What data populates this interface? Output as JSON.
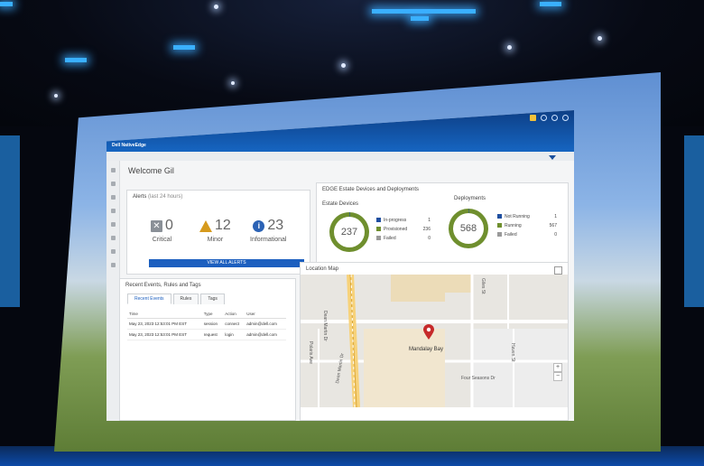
{
  "app": {
    "brand": "Dell NativeEdge"
  },
  "welcome": "Welcome Gil",
  "alerts": {
    "title": "Alerts",
    "period": "(last 24 hours)",
    "critical": {
      "count": "0",
      "label": "Critical",
      "icon": "x-icon"
    },
    "minor": {
      "count": "12",
      "label": "Minor",
      "icon": "warning-icon"
    },
    "informational": {
      "count": "23",
      "label": "Informational",
      "icon": "info-icon"
    },
    "view_all_label": "VIEW ALL ALERTS"
  },
  "estate": {
    "title": "EDGE Estate Devices and Deployments",
    "devices": {
      "title": "Estate Devices",
      "total": "237",
      "legend": [
        {
          "label": "In-progress",
          "value": "1",
          "color": "#1f4fa0"
        },
        {
          "label": "Provisioned",
          "value": "236",
          "color": "#6f8f2e"
        },
        {
          "label": "Failed",
          "value": "0",
          "color": "#9a9a9a"
        }
      ]
    },
    "deployments": {
      "title": "Deployments",
      "total": "568",
      "legend": [
        {
          "label": "Not Running",
          "value": "1",
          "color": "#1f4fa0"
        },
        {
          "label": "Running",
          "value": "567",
          "color": "#6f8f2e"
        },
        {
          "label": "Failed",
          "value": "0",
          "color": "#9a9a9a"
        }
      ]
    }
  },
  "events": {
    "title": "Recent Events, Rules and Tags",
    "tabs": [
      "Recent Events",
      "Rules",
      "Tags"
    ],
    "columns": [
      "Time",
      "Type",
      "Action",
      "User"
    ],
    "rows": [
      [
        "May 23, 2023 12:53:01 PM EST",
        "session",
        "connect",
        "admin@dell.com"
      ],
      [
        "May 23, 2023 12:53:01 PM EST",
        "request",
        "login",
        "admin@dell.com"
      ]
    ]
  },
  "map": {
    "title": "Location Map",
    "place": "Mandalay Bay",
    "streets": [
      "Dean Martin Dr",
      "Polaris Ave",
      "Giles St",
      "Haven St",
      "Four Seasons Dr",
      "Dean Martin Dr"
    ],
    "zoom_in": "+",
    "zoom_out": "−"
  }
}
